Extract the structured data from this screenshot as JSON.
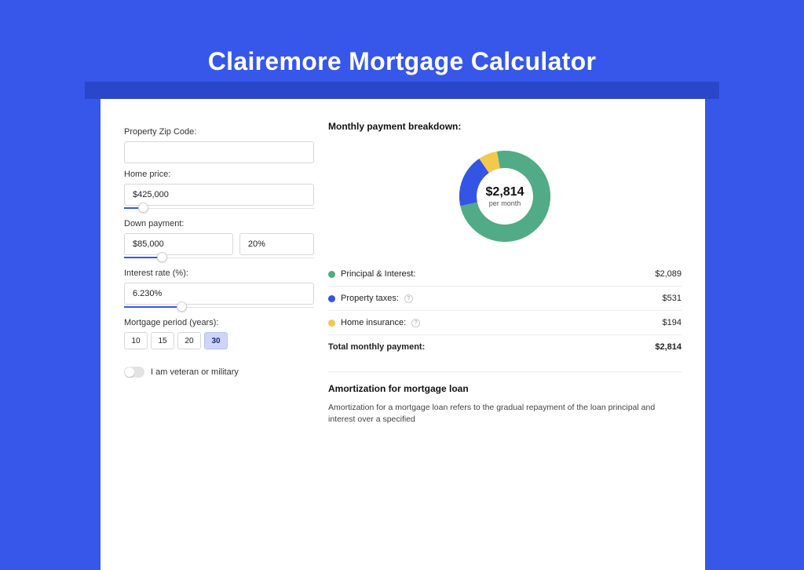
{
  "page": {
    "title": "Clairemore Mortgage Calculator"
  },
  "form": {
    "zip_label": "Property Zip Code:",
    "zip_value": "",
    "home_price_label": "Home price:",
    "home_price_value": "$425,000",
    "home_price_fill_pct": 10,
    "down_payment_label": "Down payment:",
    "down_payment_value": "$85,000",
    "down_payment_pct": "20%",
    "down_payment_fill_pct": 20,
    "interest_label": "Interest rate (%):",
    "interest_value": "6.230%",
    "interest_fill_pct": 30,
    "period_label": "Mortgage period (years):",
    "periods": [
      "10",
      "15",
      "20",
      "30"
    ],
    "period_active_index": 3,
    "veteran_label": "I am veteran or military"
  },
  "breakdown": {
    "title": "Monthly payment breakdown:",
    "center_amount": "$2,814",
    "center_sub": "per month",
    "items": [
      {
        "label": "Principal & Interest:",
        "value": "$2,089",
        "color": "#51ab86",
        "info": false
      },
      {
        "label": "Property taxes:",
        "value": "$531",
        "color": "#3454e4",
        "info": true
      },
      {
        "label": "Home insurance:",
        "value": "$194",
        "color": "#f2c94c",
        "info": true
      }
    ],
    "total_label": "Total monthly payment:",
    "total_value": "$2,814"
  },
  "chart_data": {
    "type": "pie",
    "title": "Monthly payment breakdown",
    "series": [
      {
        "name": "Principal & Interest",
        "value": 2089,
        "color": "#51ab86"
      },
      {
        "name": "Property taxes",
        "value": 531,
        "color": "#3454e4"
      },
      {
        "name": "Home insurance",
        "value": 194,
        "color": "#f2c94c"
      }
    ],
    "total": 2814,
    "inner_radius_pct": 62
  },
  "amortization": {
    "title": "Amortization for mortgage loan",
    "text": "Amortization for a mortgage loan refers to the gradual repayment of the loan principal and interest over a specified"
  }
}
